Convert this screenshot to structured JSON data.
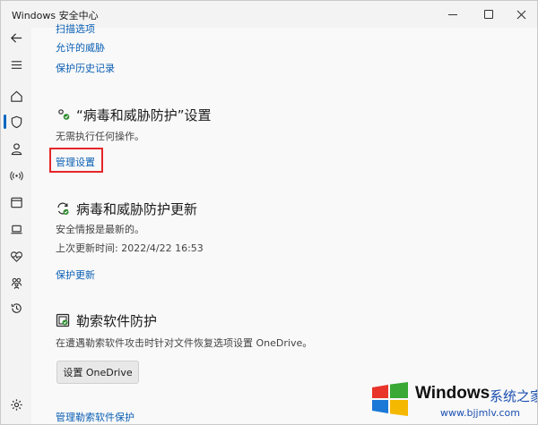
{
  "window": {
    "title": "Windows 安全中心"
  },
  "links_top": {
    "scan_options": "扫描选项",
    "allowed_threats": "允许的威胁",
    "protection_history": "保护历史记录"
  },
  "settings_section": {
    "title": "“病毒和威胁防护”设置",
    "status": "无需执行任何操作。",
    "manage_link": "管理设置"
  },
  "updates_section": {
    "title": "病毒和威胁防护更新",
    "status": "安全情报是最新的。",
    "last_update": "上次更新时间: 2022/4/22 16:53",
    "update_link": "保护更新"
  },
  "ransomware_section": {
    "title": "勒索软件防护",
    "description": "在遭遇勒索软件攻击时针对文件恢复选项设置 OneDrive。",
    "button_label": "设置 OneDrive",
    "manage_link": "管理勒索软件保护"
  },
  "watermark": {
    "brand": "Windows",
    "brand_cn": "系统之家",
    "url": "www.bjjmlv.com"
  },
  "colors": {
    "link": "#0a5fb4",
    "accent": "#0067c0",
    "highlight": "#e5262a"
  }
}
